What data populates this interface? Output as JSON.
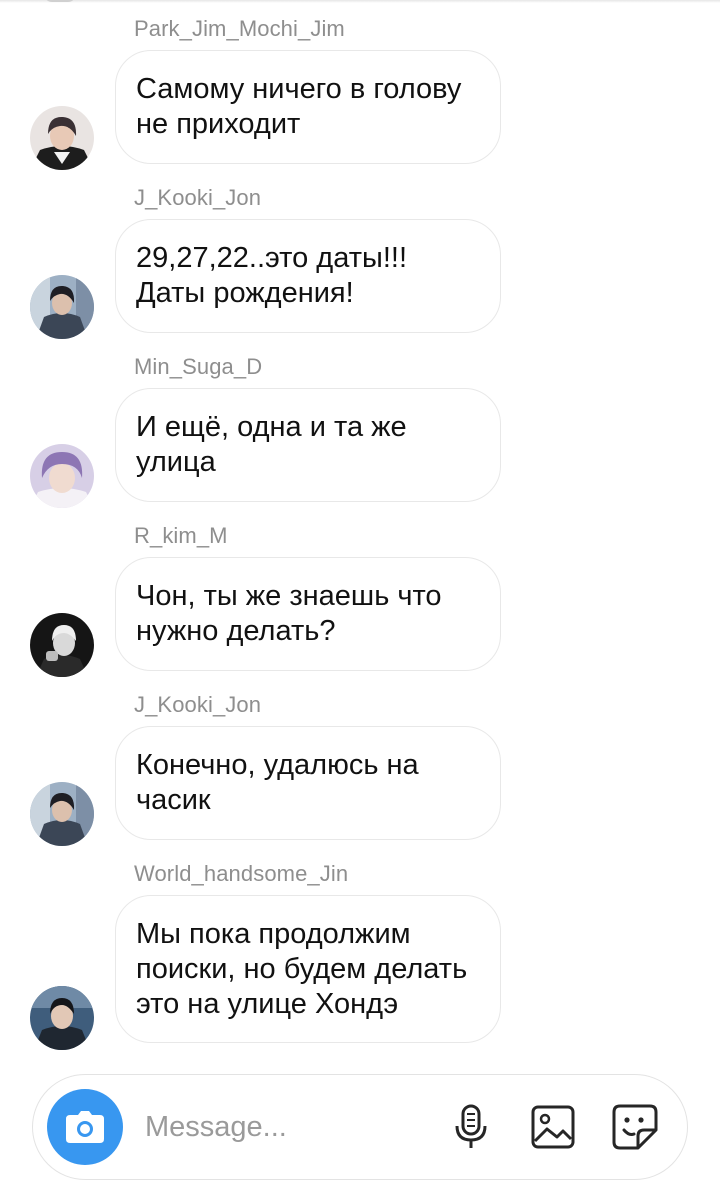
{
  "messages": [
    {
      "sender": "Park_Jim_Mochi_Jim",
      "text": "Самому ничего в голову не приходит"
    },
    {
      "sender": "J_Kooki_Jon",
      "text": "29,27,22..это даты!!! Даты рождения!"
    },
    {
      "sender": "Min_Suga_D",
      "text": "И ещё, одна и та же улица"
    },
    {
      "sender": "R_kim_M",
      "text": "Чон, ты же знаешь что нужно делать?"
    },
    {
      "sender": "J_Kooki_Jon",
      "text": "Конечно, удалюсь на часик"
    },
    {
      "sender": "World_handsome_Jin",
      "text": "Мы пока продолжим поиски, но будем делать это на улице Хондэ"
    }
  ],
  "composer": {
    "placeholder": "Message...",
    "camera_icon": "camera-icon",
    "microphone_icon": "microphone-icon",
    "gallery_icon": "image-icon",
    "sticker_icon": "sticker-icon"
  },
  "colors": {
    "accent": "#3897f0",
    "sender_text": "#8e8e8e",
    "bubble_border": "#e8e8e8"
  }
}
